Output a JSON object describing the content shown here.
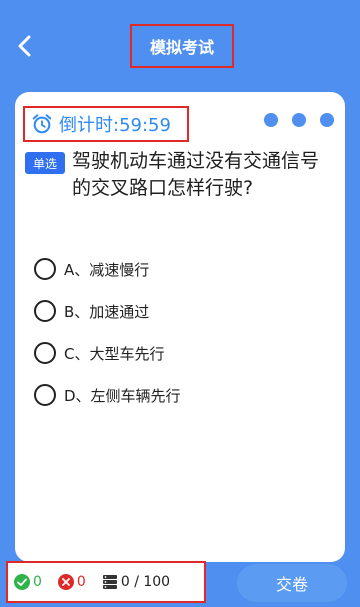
{
  "header": {
    "title": "模拟考试",
    "back_icon": "chevron-left-icon"
  },
  "timer": {
    "label": "倒计时:59:59",
    "icon": "alarm-clock-icon",
    "color": "#2e8bf5"
  },
  "more_menu": {
    "icon": "more-dots-icon"
  },
  "question": {
    "tag": "单选",
    "text": "驾驶机动车通过没有交通信号的交叉路口怎样行驶?",
    "options": [
      {
        "label": "A、减速慢行"
      },
      {
        "label": "B、加速通过"
      },
      {
        "label": "C、大型车先行"
      },
      {
        "label": "D、左侧车辆先行"
      }
    ]
  },
  "footer": {
    "correct_count": "0",
    "wrong_count": "0",
    "progress": "0 / 100",
    "submit_label": "交卷"
  },
  "colors": {
    "background": "#4f8ff0",
    "accent": "#2e8bf5",
    "highlight_border": "#e02a2a",
    "correct": "#2fb34a",
    "wrong": "#e02a2a"
  }
}
